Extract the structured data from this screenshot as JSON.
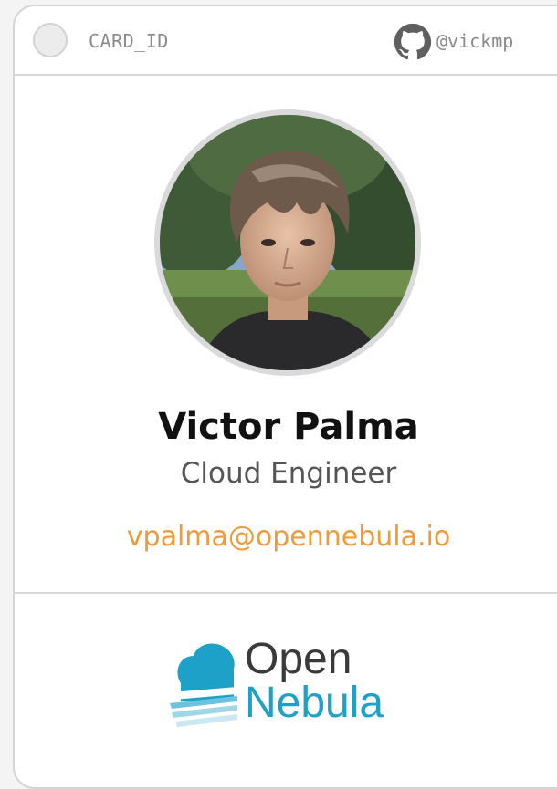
{
  "header": {
    "card_id": "CARD_ID",
    "github_handle": "@vickmp"
  },
  "profile": {
    "photo_alt": "Profile photo",
    "name": "Victor Palma",
    "role": "Cloud Engineer",
    "email": "vpalma@opennebula.io"
  },
  "logo": {
    "line1": "Open",
    "line2": "Nebula"
  },
  "colors": {
    "email": "#ef9a3c",
    "logo_primary": "#1ea1c8",
    "logo_dark": "#3a3a3a"
  },
  "icons": {
    "status": "status-dot",
    "github": "github-icon"
  }
}
